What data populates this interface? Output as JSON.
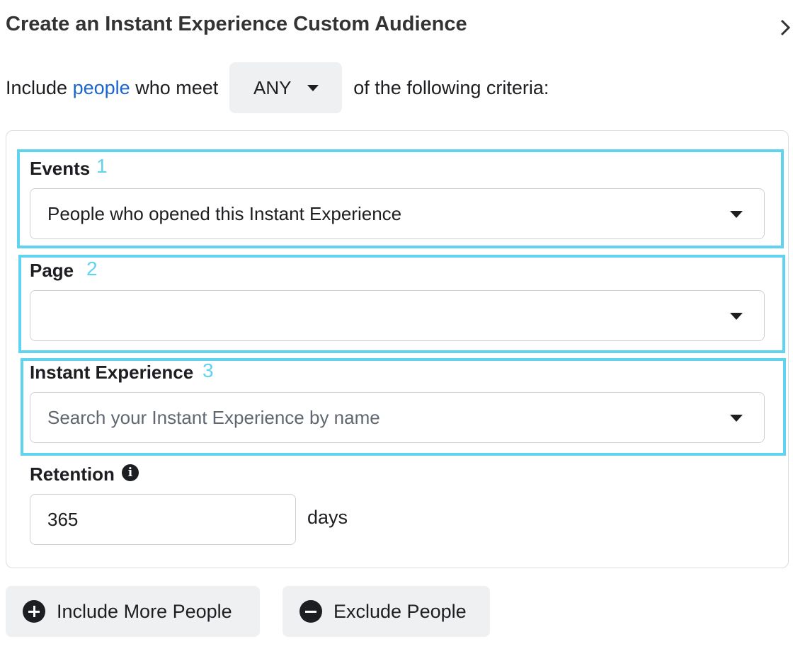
{
  "header": {
    "title": "Create an Instant Experience Custom Audience",
    "close_icon": "chevron-right-icon"
  },
  "criteria": {
    "prefix": "Include",
    "link_text": "people",
    "middle": "who meet",
    "match_value": "ANY",
    "suffix": "of the following criteria:"
  },
  "fields": {
    "events": {
      "label": "Events",
      "number": "1",
      "value": "People who opened this Instant Experience"
    },
    "page": {
      "label": "Page",
      "number": "2",
      "value": ""
    },
    "instant_experience": {
      "label": "Instant Experience",
      "number": "3",
      "placeholder": "Search your Instant Experience by name"
    },
    "retention": {
      "label": "Retention",
      "value": "365",
      "unit": "days"
    }
  },
  "actions": {
    "include_label": "Include More People",
    "exclude_label": "Exclude People"
  },
  "colors": {
    "highlight": "#5fd3f0",
    "link": "#1a66cc",
    "button_bg": "#eef0f2"
  }
}
